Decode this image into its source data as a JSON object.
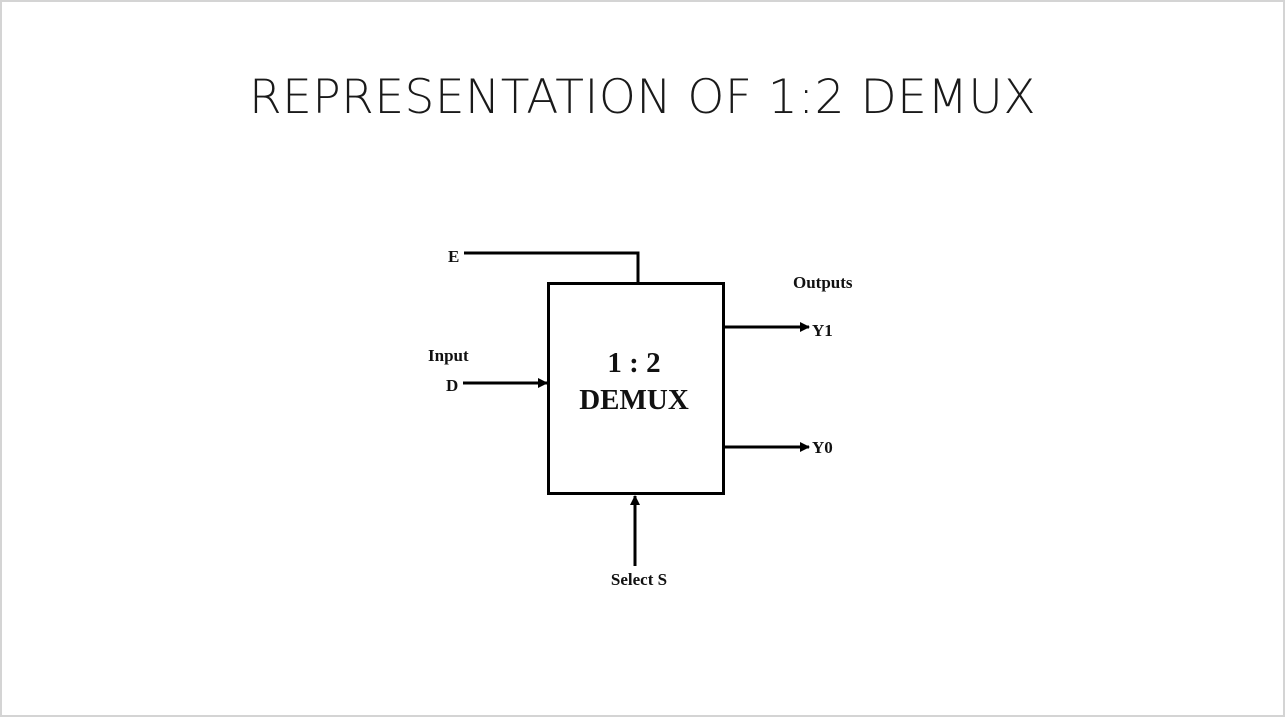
{
  "slide": {
    "title": "REPRESENTATION OF 1:2 DEMUX"
  },
  "diagram": {
    "enable_label": "E",
    "input_label": "Input",
    "input_signal": "D",
    "block_ratio": "1 : 2",
    "block_name": "DEMUX",
    "outputs_label": "Outputs",
    "output_y1": "Y1",
    "output_y0": "Y0",
    "select_label": "Select S"
  }
}
